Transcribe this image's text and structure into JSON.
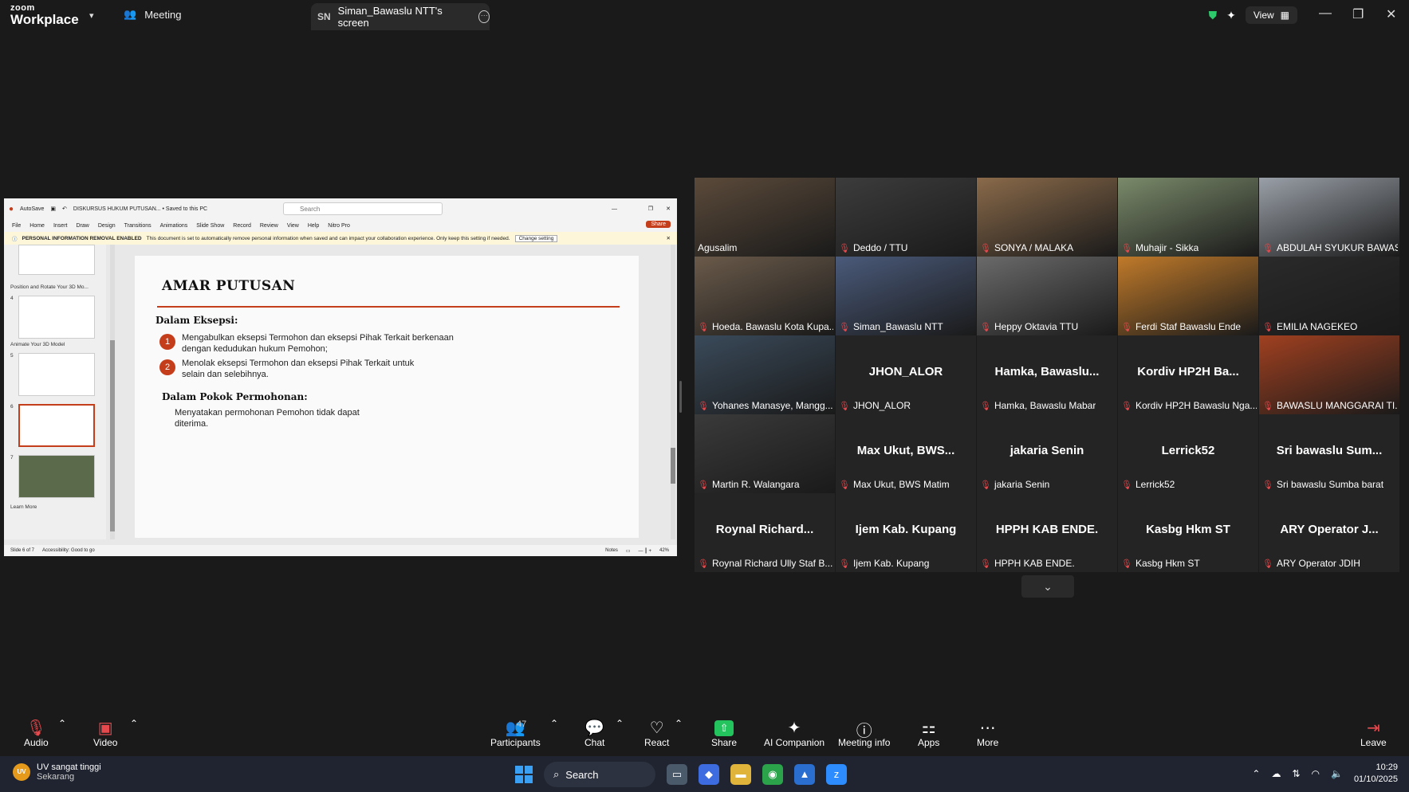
{
  "zoom": {
    "logo_line1": "zoom",
    "logo_line2": "Workplace",
    "meeting_tab": "Meeting",
    "screen_tab_initials": "SN",
    "screen_tab_label": "Siman_Bawaslu NTT's screen",
    "view_label": "View"
  },
  "ppt": {
    "autosave": "AutoSave",
    "doc_title": "DISKURSUS HUKUM PUTUSAN... • Saved to this PC",
    "search_placeholder": "Search",
    "menu": [
      "File",
      "Home",
      "Insert",
      "Draw",
      "Design",
      "Transitions",
      "Animations",
      "Slide Show",
      "Record",
      "Review",
      "View",
      "Help",
      "Nitro Pro"
    ],
    "share_label": "Share",
    "info_label": "PERSONAL INFORMATION REMOVAL ENABLED",
    "info_text": "This document is set to automatically remove personal information when saved and can impact your collaboration experience. Only keep this setting if needed.",
    "info_button": "Change setting",
    "thumb_sections": [
      "Position and Rotate Your 3D Mo...",
      "Animate Your 3D Model",
      "Learn More"
    ],
    "thumb_numbers": [
      "4",
      "5",
      "6",
      "7"
    ],
    "status_left": "Slide 6 of 7",
    "status_access": "Accessibility: Good to go",
    "status_notes": "Notes",
    "status_zoom": "42%"
  },
  "slide": {
    "title": "AMAR PUTUSAN",
    "sub1": "Dalam Eksepsi:",
    "items": [
      {
        "num": "1",
        "line1": "Mengabulkan eksepsi Termohon dan eksepsi Pihak Terkait berkenaan",
        "line2": "dengan kedudukan hukum Pemohon;"
      },
      {
        "num": "2",
        "line1": "Menolak eksepsi Termohon dan eksepsi Pihak Terkait untuk",
        "line2": "selain dan selebihnya."
      }
    ],
    "sub2": "Dalam Pokok Permohonan:",
    "para_line1": "Menyatakan permohonan Pemohon tidak dapat",
    "para_line2": "diterima."
  },
  "gallery": [
    {
      "name": "Agusalim",
      "video": true,
      "muted": false,
      "active": true
    },
    {
      "name": "Deddo / TTU",
      "video": true,
      "muted": true
    },
    {
      "name": "SONYA / MALAKA",
      "video": true,
      "muted": true
    },
    {
      "name": "Muhajir - Sikka",
      "video": true,
      "muted": true
    },
    {
      "name": "ABDULAH SYUKUR BAWASL...",
      "video": true,
      "muted": true
    },
    {
      "name": "Hoeda. Bawaslu Kota Kupa...",
      "video": true,
      "muted": true
    },
    {
      "name": "Siman_Bawaslu NTT",
      "video": true,
      "muted": true
    },
    {
      "name": "Heppy Oktavia TTU",
      "video": true,
      "muted": true
    },
    {
      "name": "Ferdi Staf Bawaslu Ende",
      "video": true,
      "muted": true
    },
    {
      "name": "EMILIA NAGEKEO",
      "video": true,
      "muted": true
    },
    {
      "name": "Yohanes Manasye, Mangg...",
      "video": true,
      "muted": true
    },
    {
      "name": "JHON_ALOR",
      "big": "JHON_ALOR",
      "video": false,
      "muted": true
    },
    {
      "name": "Hamka, Bawaslu Mabar",
      "big": "Hamka, Bawaslu...",
      "video": false,
      "muted": true
    },
    {
      "name": "Kordiv HP2H Bawaslu Nga...",
      "big": "Kordiv HP2H Ba...",
      "video": false,
      "muted": true
    },
    {
      "name": "BAWASLU MANGGARAI TI...",
      "video": true,
      "muted": true
    },
    {
      "name": "Martin R. Walangara",
      "video": true,
      "muted": true
    },
    {
      "name": "Max Ukut, BWS Matim",
      "big": "Max Ukut, BWS...",
      "video": false,
      "muted": true
    },
    {
      "name": "jakaria Senin",
      "big": "jakaria Senin",
      "video": false,
      "muted": true
    },
    {
      "name": "Lerrick52",
      "big": "Lerrick52",
      "video": false,
      "muted": true
    },
    {
      "name": "Sri bawaslu Sumba barat",
      "big": "Sri bawaslu Sum...",
      "video": false,
      "muted": true
    },
    {
      "name": "Roynal Richard Ully Staf B...",
      "big": "Roynal Richard...",
      "video": false,
      "muted": true
    },
    {
      "name": "Ijem Kab. Kupang",
      "big": "Ijem Kab. Kupang",
      "video": false,
      "muted": true
    },
    {
      "name": "HPPH KAB ENDE.",
      "big": "HPPH KAB ENDE.",
      "video": false,
      "muted": true
    },
    {
      "name": "Kasbg Hkm ST",
      "big": "Kasbg Hkm ST",
      "video": false,
      "muted": true
    },
    {
      "name": "ARY Operator JDIH",
      "big": "ARY Operator J...",
      "video": false,
      "muted": true
    }
  ],
  "controls": {
    "audio": "Audio",
    "video": "Video",
    "participants": "Participants",
    "participants_count": "47",
    "chat": "Chat",
    "react": "React",
    "share": "Share",
    "ai": "AI Companion",
    "info": "Meeting info",
    "apps": "Apps",
    "more": "More",
    "leave": "Leave"
  },
  "taskbar": {
    "weather_icon": "UV",
    "weather_title": "UV sangat tinggi",
    "weather_sub": "Sekarang",
    "search": "Search",
    "time": "10:29",
    "date": "01/10/2025"
  },
  "colors": {
    "accent_green": "#2dc96b",
    "mute_red": "#e5494d",
    "ppt_red": "#c43e1c"
  }
}
